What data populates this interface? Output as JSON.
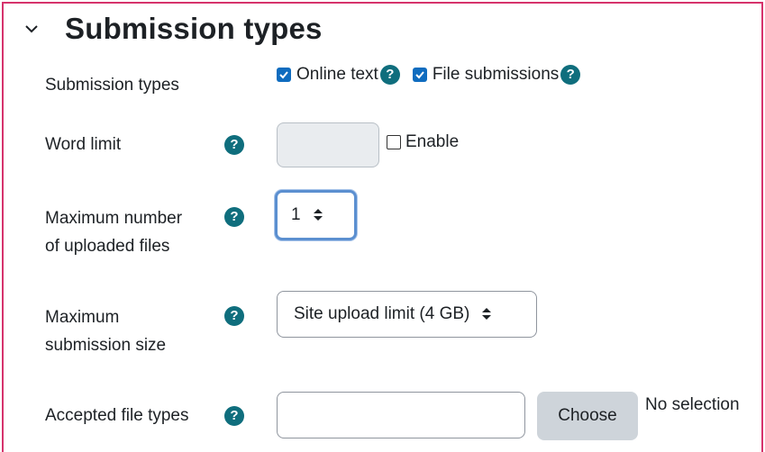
{
  "section": {
    "title": "Submission types",
    "collapse_icon": "chevron-down-icon"
  },
  "submission_types": {
    "label": "Submission types",
    "options": [
      {
        "label": "Online text",
        "checked": true
      },
      {
        "label": "File submissions",
        "checked": true
      }
    ]
  },
  "word_limit": {
    "label": "Word limit",
    "value": "",
    "enable_label": "Enable",
    "enable_checked": false
  },
  "max_files": {
    "label_line1": "Maximum number",
    "label_line2": "of uploaded files",
    "selected": "1"
  },
  "max_size": {
    "label_line1": "Maximum",
    "label_line2": "submission size",
    "selected": "Site upload limit (4 GB)"
  },
  "file_types": {
    "label": "Accepted file types",
    "value": "",
    "choose_label": "Choose",
    "status": "No selection"
  },
  "help_icon": "?",
  "colors": {
    "accent_border": "#d6336c",
    "help_icon_bg": "#0f6e7d",
    "checkbox_bg": "#0f6cbf",
    "focus_ring": "#5b8fd0",
    "button_bg": "#ced4da"
  }
}
